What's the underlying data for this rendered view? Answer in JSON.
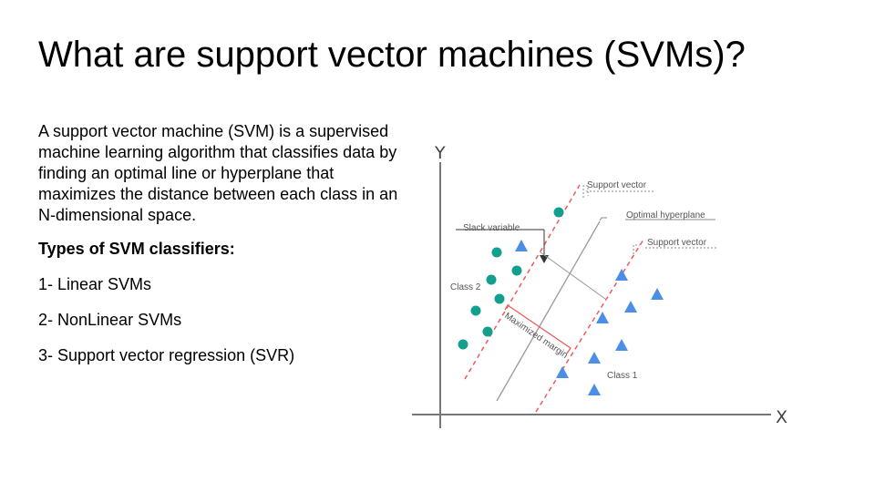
{
  "slide": {
    "title": "What are support vector machines (SVMs)?",
    "intro": "A support vector machine (SVM) is a supervised machine learning algorithm that classifies data by finding an optimal line or hyperplane that maximizes the distance between each class in an N-dimensional space.",
    "types_heading": "Types of SVM classifiers:",
    "types": [
      "1- Linear SVMs",
      "2- NonLinear SVMs",
      "3- Support vector regression (SVR)"
    ]
  },
  "diagram": {
    "axis_y": "Y",
    "axis_x": "X",
    "labels": {
      "support_vector_top": "Support vector",
      "optimal_hyperplane": "Optimal hyperplane",
      "support_vector_right": "Support vector",
      "slack_variable": "Slack variable",
      "class_2": "Class 2",
      "class_1": "Class 1",
      "maximized_margin": "Maximized margin"
    },
    "colors": {
      "class_2_circle": "#139f8d",
      "class_1_triangle": "#4b8ee6",
      "margin_line": "#f05a5a",
      "hyperplane": "#999999",
      "axis": "#777777"
    }
  }
}
